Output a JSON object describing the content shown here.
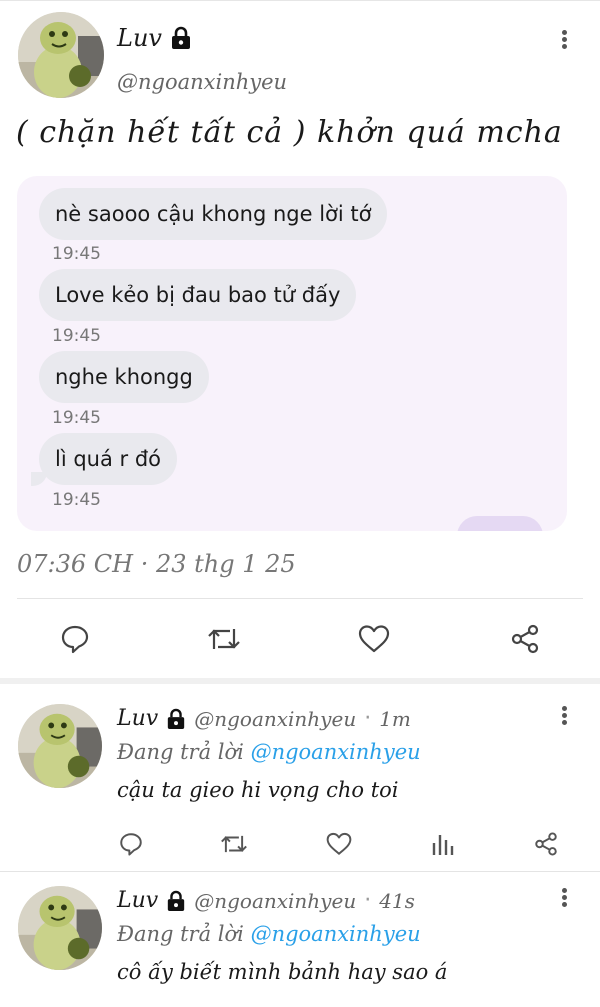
{
  "main_post": {
    "author_name": "Luv",
    "handle": "@ngoanxinhyeu",
    "text": "( chặn hết tất cả ) khởn quá mcha",
    "chat": [
      {
        "text": "nè saooo cậu khong nge lời tớ",
        "time": "19:45"
      },
      {
        "text": "Love kẻo bị đau bao tử đấy",
        "time": "19:45"
      },
      {
        "text": "nghe khongg",
        "time": "19:45"
      },
      {
        "text": "lì quá r đó",
        "time": "19:45"
      }
    ],
    "timestamp": "07:36 CH · 23 thg 1 25",
    "actions": [
      "reply-icon",
      "repost-icon",
      "like-icon",
      "share-icon"
    ]
  },
  "replies": [
    {
      "author_name": "Luv",
      "handle": "@ngoanxinhyeu",
      "separator": "·",
      "time": "1m",
      "replying_label": "Đang trả lời",
      "replying_to": "@ngoanxinhyeu",
      "text": "cậu ta gieo hi vọng cho toi"
    },
    {
      "author_name": "Luv",
      "handle": "@ngoanxinhyeu",
      "separator": "·",
      "time": "41s",
      "replying_label": "Đang trả lời",
      "replying_to": "@ngoanxinhyeu",
      "text": "cô ấy biết mình bảnh hay sao á"
    }
  ],
  "colors": {
    "chat_background": "#f8f2fb",
    "bubble": "#e9e9ee",
    "mention": "#2aa0e8",
    "secondary_text": "#666666"
  }
}
